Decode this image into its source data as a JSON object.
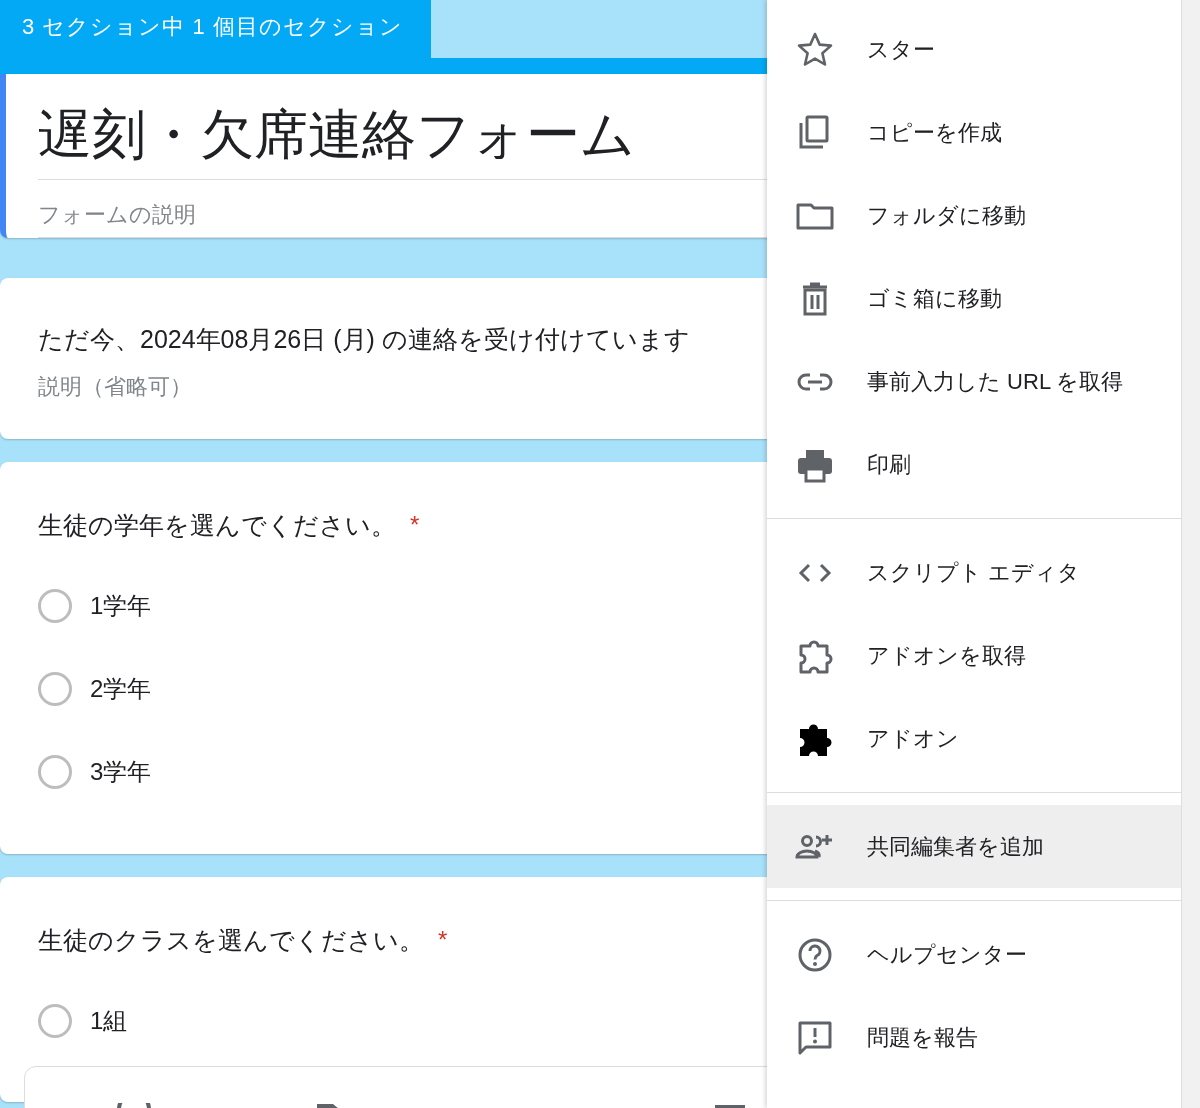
{
  "section_tab": "3 セクション中 1 個目のセクション",
  "form_header": {
    "title": "遅刻・欠席連絡フォーム",
    "description_placeholder": "フォームの説明"
  },
  "sections": [
    {
      "kind": "text",
      "title": "ただ今、2024年08月26日 (月) の連絡を受け付けています",
      "description_placeholder": "説明（省略可）"
    },
    {
      "kind": "question",
      "title": "生徒の学年を選んでください。",
      "required_mark": "*",
      "options": [
        {
          "label": "1学年",
          "selected": false
        },
        {
          "label": "2学年",
          "selected": false
        },
        {
          "label": "3学年",
          "selected": false
        }
      ]
    },
    {
      "kind": "question",
      "title": "生徒のクラスを選んでください。",
      "required_mark": "*",
      "options": [
        {
          "label": "1組",
          "selected": false
        }
      ]
    }
  ],
  "menu": {
    "groups": [
      [
        {
          "label": "スター",
          "highlighted": false
        },
        {
          "label": "コピーを作成",
          "highlighted": false
        },
        {
          "label": "フォルダに移動",
          "highlighted": false
        },
        {
          "label": "ゴミ箱に移動",
          "highlighted": false
        },
        {
          "label": "事前入力した URL を取得",
          "highlighted": false
        },
        {
          "label": "印刷",
          "highlighted": false
        }
      ],
      [
        {
          "label": "スクリプト エディタ",
          "highlighted": false
        },
        {
          "label": "アドオンを取得",
          "highlighted": false
        },
        {
          "label": "アドオン",
          "highlighted": false
        }
      ],
      [
        {
          "label": "共同編集者を追加",
          "highlighted": true
        }
      ],
      [
        {
          "label": "ヘルプセンター",
          "highlighted": false
        },
        {
          "label": "問題を報告",
          "highlighted": false
        }
      ]
    ]
  }
}
